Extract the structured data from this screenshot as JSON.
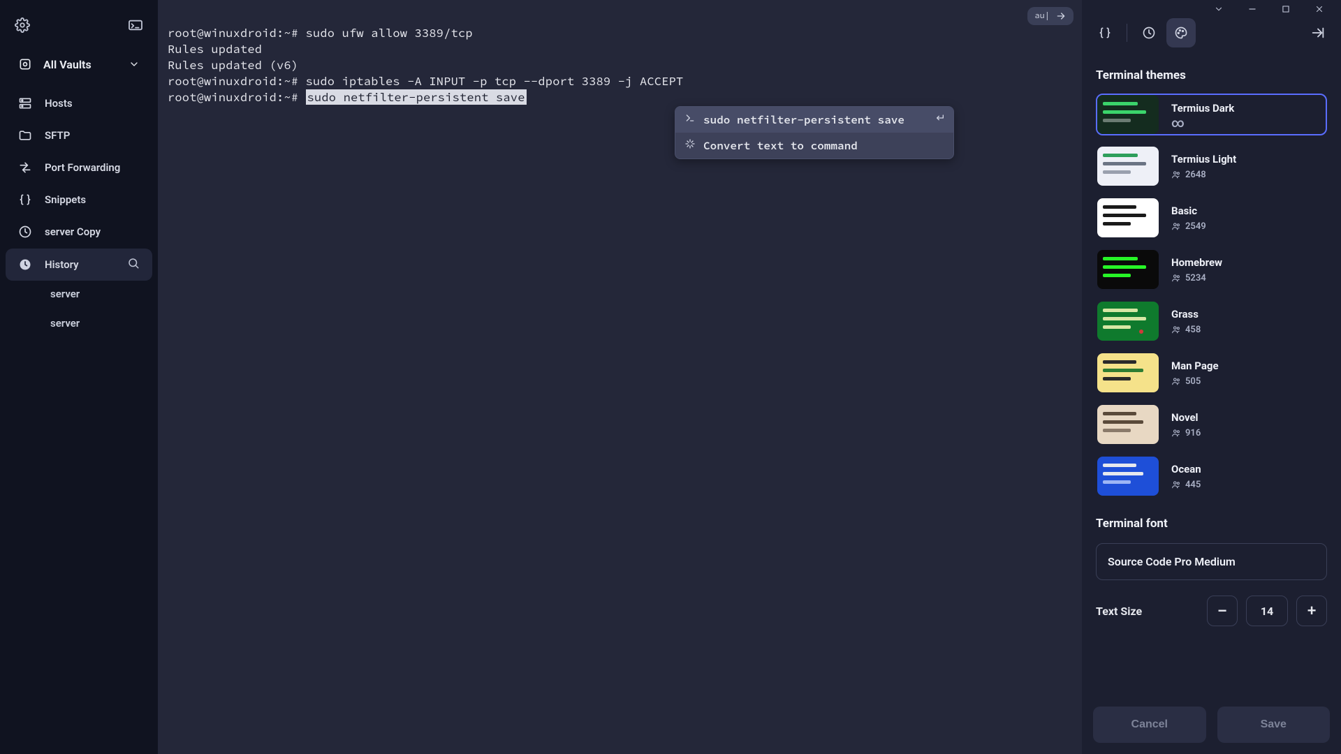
{
  "sidebar": {
    "all_vaults": "All Vaults",
    "items": [
      {
        "label": "Hosts"
      },
      {
        "label": "SFTP"
      },
      {
        "label": "Port Forwarding"
      },
      {
        "label": "Snippets"
      },
      {
        "label": "server Copy"
      },
      {
        "label": "History"
      }
    ],
    "history_children": [
      "server",
      "server"
    ]
  },
  "terminal": {
    "pill_text": "au|",
    "lines": [
      {
        "prompt": "root@winuxdroid:~# ",
        "cmd": "sudo ufw allow 3389/tcp",
        "highlight": false
      },
      {
        "prompt": "",
        "cmd": "Rules updated",
        "highlight": false
      },
      {
        "prompt": "",
        "cmd": "Rules updated (v6)",
        "highlight": false
      },
      {
        "prompt": "root@winuxdroid:~# ",
        "cmd": "sudo iptables -A INPUT -p tcp --dport 3389 -j ACCEPT",
        "highlight": false
      },
      {
        "prompt": "root@winuxdroid:~# ",
        "cmd": "sudo netfilter-persistent save",
        "highlight": true
      }
    ],
    "suggestions": [
      {
        "text": "sudo netfilter-persistent save",
        "kind": "command"
      },
      {
        "text": "Convert text to command",
        "kind": "action"
      }
    ]
  },
  "right_panel": {
    "themes_title": "Terminal themes",
    "themes": [
      {
        "name": "Termius Dark",
        "count": "∞",
        "thumb": "thumb-dark",
        "selected": true
      },
      {
        "name": "Termius Light",
        "count": "2648",
        "thumb": "thumb-light",
        "selected": false
      },
      {
        "name": "Basic",
        "count": "2549",
        "thumb": "thumb-basic",
        "selected": false
      },
      {
        "name": "Homebrew",
        "count": "5234",
        "thumb": "thumb-homebrew",
        "selected": false
      },
      {
        "name": "Grass",
        "count": "458",
        "thumb": "thumb-grass",
        "selected": false
      },
      {
        "name": "Man Page",
        "count": "505",
        "thumb": "thumb-manpage",
        "selected": false
      },
      {
        "name": "Novel",
        "count": "916",
        "thumb": "thumb-novel",
        "selected": false
      },
      {
        "name": "Ocean",
        "count": "445",
        "thumb": "thumb-ocean",
        "selected": false
      }
    ],
    "font_title": "Terminal font",
    "font_value": "Source Code Pro Medium",
    "text_size_label": "Text Size",
    "text_size_value": "14",
    "cancel": "Cancel",
    "save": "Save"
  }
}
